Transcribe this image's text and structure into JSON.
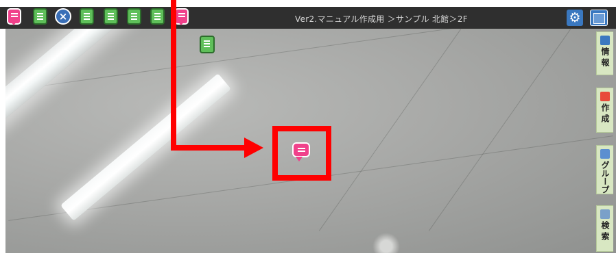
{
  "header": {
    "breadcrumb": "Ver2.マニュアル作成用 ＞サンプル 北館＞2F"
  },
  "toolbar": {
    "icons": [
      "comment-icon",
      "note-icon",
      "close-icon",
      "note-icon",
      "note-icon",
      "note-icon",
      "note-icon",
      "comment-icon"
    ],
    "settings_icon": "gear-icon",
    "panel_icon": "panel-toggle-icon"
  },
  "side_tabs": [
    {
      "label": "情報",
      "icon": "document-icon"
    },
    {
      "label": "作成",
      "icon": "create-icon"
    },
    {
      "label": "グループ",
      "icon": "group-icon"
    },
    {
      "label": "検索",
      "icon": "search-icon"
    }
  ],
  "markers": [
    {
      "type": "note",
      "icon": "note-icon"
    },
    {
      "type": "comment",
      "icon": "comment-icon"
    }
  ],
  "annotation": {
    "highlight_color": "#ff0000"
  },
  "colors": {
    "accent_blue": "#3a78c0",
    "note_green": "#5fbf5a",
    "comment_pink": "#f0418b",
    "side_tab_bg": "#d8e7c2"
  }
}
